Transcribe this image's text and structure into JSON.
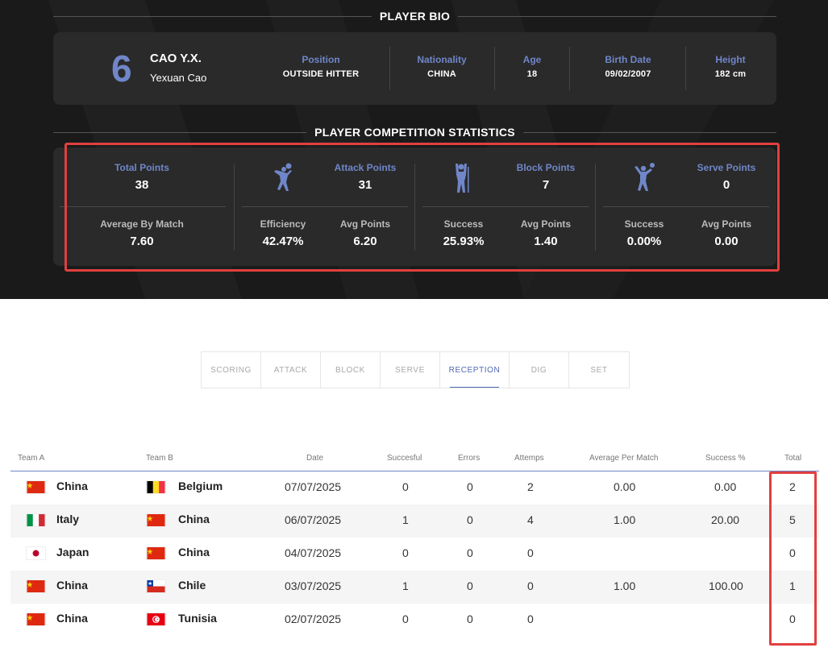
{
  "bio": {
    "title": "PLAYER BIO",
    "number": "6",
    "short_name": "CAO Y.X.",
    "full_name": "Yexuan Cao",
    "position_label": "Position",
    "position": "OUTSIDE HITTER",
    "nationality_label": "Nationality",
    "nationality": "CHINA",
    "age_label": "Age",
    "age": "18",
    "birth_label": "Birth Date",
    "birth": "09/02/2007",
    "height_label": "Height",
    "height": "182 cm"
  },
  "stats": {
    "title": "PLAYER COMPETITION STATISTICS",
    "total_label": "Total Points",
    "total": "38",
    "avg_match_label": "Average By Match",
    "avg_match": "7.60",
    "attack_label": "Attack Points",
    "attack": "31",
    "attack_eff_label": "Efficiency",
    "attack_eff": "42.47%",
    "attack_avg_label": "Avg Points",
    "attack_avg": "6.20",
    "block_label": "Block Points",
    "block": "7",
    "block_succ_label": "Success",
    "block_succ": "25.93%",
    "block_avg_label": "Avg Points",
    "block_avg": "1.40",
    "serve_label": "Serve Points",
    "serve": "0",
    "serve_succ_label": "Success",
    "serve_succ": "0.00%",
    "serve_avg_label": "Avg Points",
    "serve_avg": "0.00",
    "icons": [
      "attack-player-icon",
      "block-player-icon",
      "serve-player-icon"
    ]
  },
  "tabs": [
    "SCORING",
    "ATTACK",
    "BLOCK",
    "SERVE",
    "RECEPTION",
    "DIG",
    "SET"
  ],
  "selected_tab": "RECEPTION",
  "table": {
    "headers": [
      "Team A",
      "Team B",
      "Date",
      "Succesful",
      "Errors",
      "Attemps",
      "Average Per Match",
      "Success %",
      "Total"
    ],
    "rows": [
      {
        "team_a": "China",
        "team_b": "Belgium",
        "date": "07/07/2025",
        "succ": "0",
        "err": "0",
        "att": "2",
        "avg": "0.00",
        "pct": "0.00",
        "total": "2"
      },
      {
        "team_a": "Italy",
        "team_b": "China",
        "date": "06/07/2025",
        "succ": "1",
        "err": "0",
        "att": "4",
        "avg": "1.00",
        "pct": "20.00",
        "total": "5"
      },
      {
        "team_a": "Japan",
        "team_b": "China",
        "date": "04/07/2025",
        "succ": "0",
        "err": "0",
        "att": "0",
        "avg": "",
        "pct": "",
        "total": "0"
      },
      {
        "team_a": "China",
        "team_b": "Chile",
        "date": "03/07/2025",
        "succ": "1",
        "err": "0",
        "att": "0",
        "avg": "1.00",
        "pct": "100.00",
        "total": "1"
      },
      {
        "team_a": "China",
        "team_b": "Tunisia",
        "date": "02/07/2025",
        "succ": "0",
        "err": "0",
        "att": "0",
        "avg": "",
        "pct": "",
        "total": "0"
      }
    ]
  },
  "colors": {
    "accent": "#6f86c9",
    "highlight": "#e0403f",
    "dark_bg": "#1a1a1a",
    "card_bg": "#2a2a2a"
  }
}
